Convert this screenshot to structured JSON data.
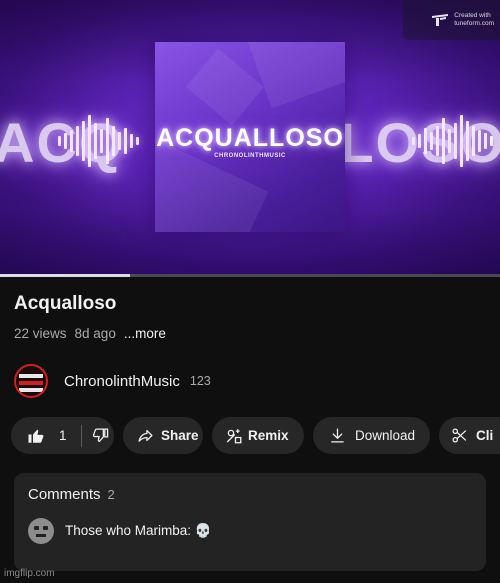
{
  "player": {
    "glow_text_left": "ACQ",
    "glow_text_right": "LOSO",
    "cover_title": "ACQUALLOSO",
    "cover_subtitle": "CHRONOLINTHMUSIC",
    "progress_fraction": 0.26,
    "watermark": {
      "line1": "Created with",
      "line2": "tuneform.com"
    }
  },
  "video": {
    "title": "Acqualloso",
    "views": "22 views",
    "age": "8d ago",
    "more_label": "...more"
  },
  "channel": {
    "name": "ChronolinthMusic",
    "subscribers": "123"
  },
  "actions": {
    "like_count": "1",
    "share_label": "Share",
    "remix_label": "Remix",
    "download_label": "Download",
    "clip_label": "Cli"
  },
  "comments": {
    "title": "Comments",
    "count": "2",
    "top_comment": "Those who Marimba: 💀"
  },
  "footer": {
    "watermark": "imgflip.com"
  },
  "icons": [
    "thumbs-up-icon",
    "thumbs-down-icon",
    "share-icon",
    "remix-icon",
    "download-icon",
    "scissors-icon",
    "tuneform-logo-icon"
  ],
  "colors": {
    "background": "#0f0f0f",
    "pill": "#272727",
    "accent_purple": "#6a34c9"
  }
}
